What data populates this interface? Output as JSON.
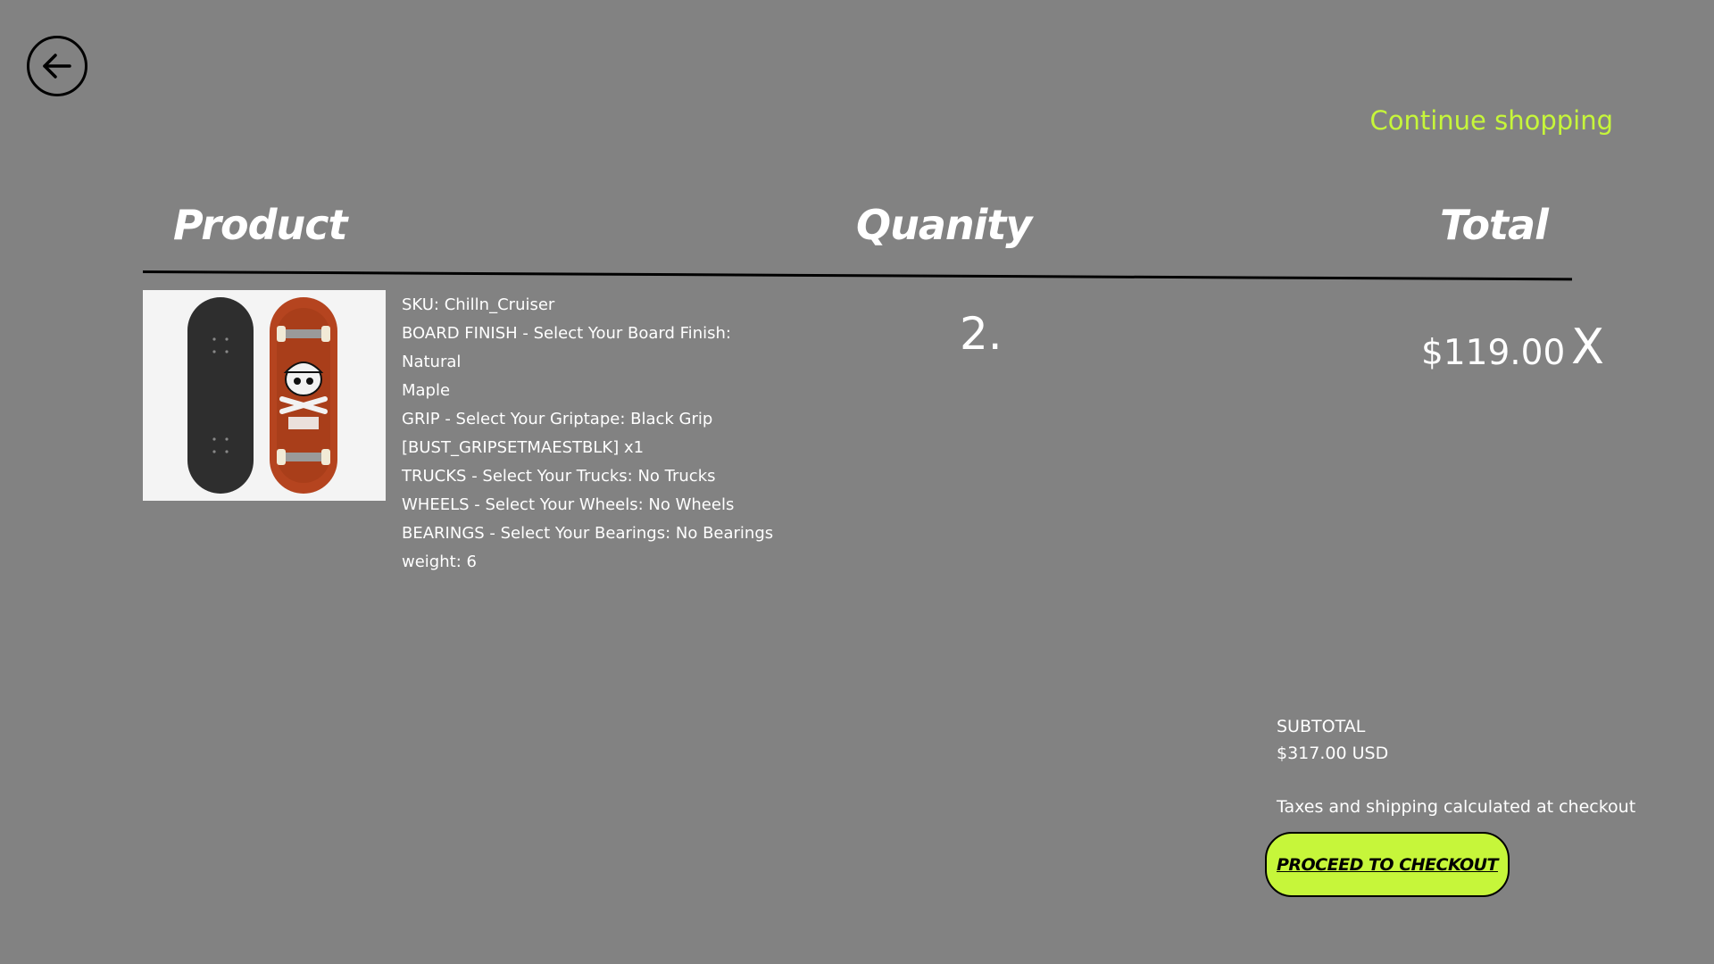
{
  "header": {
    "back_icon": "arrow-left-circle-icon",
    "continue_label": "Continue shopping"
  },
  "table": {
    "columns": {
      "product": "Product",
      "quantity": "Quanity",
      "total": "Total"
    }
  },
  "cart": {
    "items": [
      {
        "details": {
          "sku": "SKU: Chilln_Cruiser",
          "board_finish_1": "BOARD FINISH - Select Your Board Finish: Natural",
          "board_finish_2": "Maple",
          "grip_1": "GRIP - Select Your Griptape: Black Grip",
          "grip_2": "[BUST_GRIPSETMAESTBLK] x1",
          "trucks": "TRUCKS - Select Your Trucks: No Trucks",
          "wheels": "WHEELS - Select Your Wheels: No Wheels",
          "bearings": "BEARINGS - Select Your Bearings: No Bearings",
          "weight": "weight: 6"
        },
        "quantity": "2.",
        "price": "$119.00",
        "remove_label": "X"
      }
    ]
  },
  "summary": {
    "subtotal_label": "SUBTOTAL",
    "subtotal_value": "$317.00 USD",
    "tax_note": "Taxes and shipping calculated at checkout",
    "checkout_label": "PROCEED TO CHECKOUT"
  },
  "colors": {
    "background": "#828282",
    "accent": "#c6f63a",
    "text": "#ffffff",
    "board_red": "#b5441f",
    "board_grip": "#2e2e2e"
  }
}
